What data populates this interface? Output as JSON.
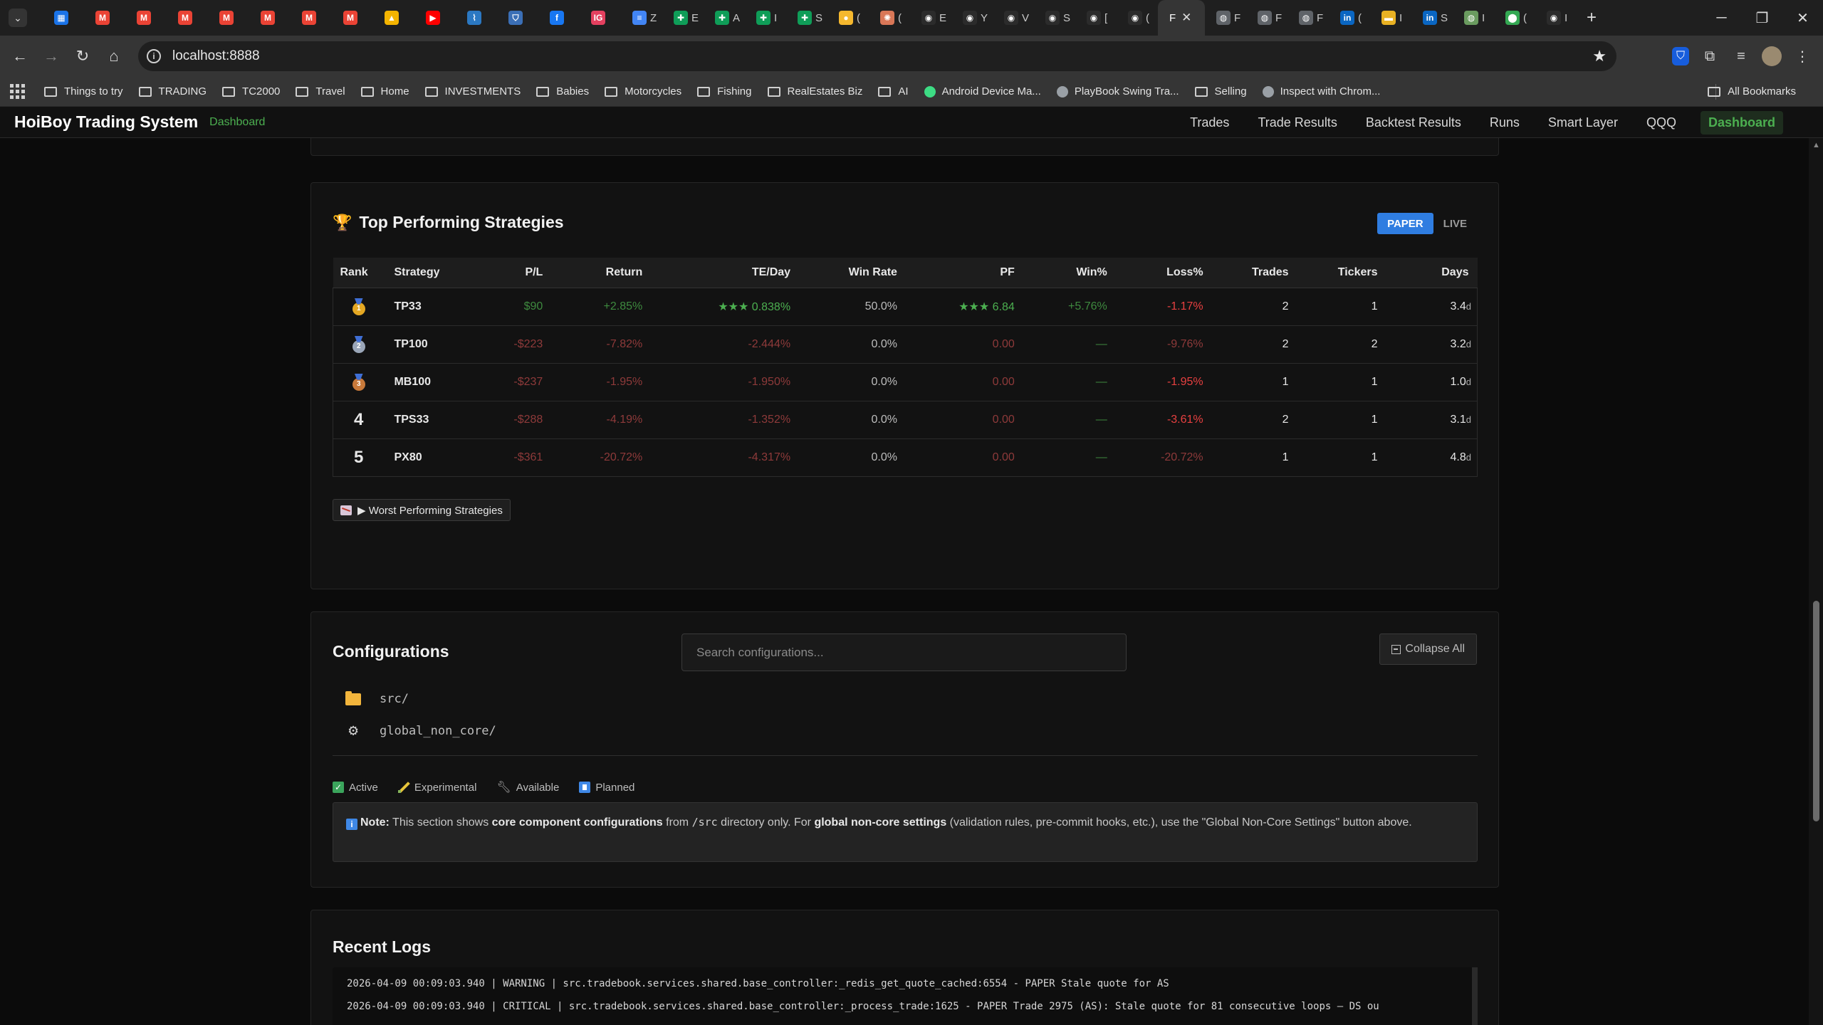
{
  "browser": {
    "tabs": [
      {
        "icon": "calendar-icon",
        "color": "#1a73e8",
        "glyph": "▦",
        "label": ""
      },
      {
        "icon": "gmail-icon",
        "color": "#ea4335",
        "glyph": "M",
        "label": ""
      },
      {
        "icon": "gmail-icon",
        "color": "#ea4335",
        "glyph": "M",
        "label": ""
      },
      {
        "icon": "gmail-icon",
        "color": "#ea4335",
        "glyph": "M",
        "label": ""
      },
      {
        "icon": "gmail-icon",
        "color": "#ea4335",
        "glyph": "M",
        "label": ""
      },
      {
        "icon": "gmail-icon",
        "color": "#ea4335",
        "glyph": "M",
        "label": ""
      },
      {
        "icon": "gmail-icon",
        "color": "#ea4335",
        "glyph": "M",
        "label": ""
      },
      {
        "icon": "gmail-icon",
        "color": "#ea4335",
        "glyph": "M",
        "label": ""
      },
      {
        "icon": "drive-icon",
        "color": "#f4b400",
        "glyph": "▲",
        "label": ""
      },
      {
        "icon": "youtube-icon",
        "color": "#ff0000",
        "glyph": "▶",
        "label": ""
      },
      {
        "icon": "chart-icon",
        "color": "#2b78c2",
        "glyph": "⌇",
        "label": ""
      },
      {
        "icon": "shield-icon",
        "color": "#3b6fb6",
        "glyph": "⛉",
        "label": ""
      },
      {
        "icon": "f-icon",
        "color": "#1877f2",
        "glyph": "f",
        "label": ""
      },
      {
        "icon": "ig-icon",
        "color": "#e4405f",
        "glyph": "IG",
        "label": ""
      },
      {
        "icon": "docs-icon",
        "color": "#4285f4",
        "glyph": "≡",
        "label": "Z"
      },
      {
        "icon": "sheets-icon",
        "color": "#0f9d58",
        "glyph": "✚",
        "label": "E"
      },
      {
        "icon": "sheets-icon",
        "color": "#0f9d58",
        "glyph": "✚",
        "label": "A"
      },
      {
        "icon": "sheets-icon",
        "color": "#0f9d58",
        "glyph": "✚",
        "label": "I"
      },
      {
        "icon": "sheets-icon",
        "color": "#0f9d58",
        "glyph": "✚",
        "label": "S"
      },
      {
        "icon": "sun-icon",
        "color": "#f5b82e",
        "glyph": "●",
        "label": "("
      },
      {
        "icon": "spark-icon",
        "color": "#d97757",
        "glyph": "✺",
        "label": "("
      },
      {
        "icon": "github-icon",
        "color": "#2b2b2b",
        "glyph": "◉",
        "label": "E"
      },
      {
        "icon": "github-icon",
        "color": "#2b2b2b",
        "glyph": "◉",
        "label": "Y"
      },
      {
        "icon": "github-icon",
        "color": "#2b2b2b",
        "glyph": "◉",
        "label": "V"
      },
      {
        "icon": "github-icon",
        "color": "#2b2b2b",
        "glyph": "◉",
        "label": "S"
      },
      {
        "icon": "github-icon",
        "color": "#2b2b2b",
        "glyph": "◉",
        "label": "["
      },
      {
        "icon": "github-icon",
        "color": "#2b2b2b",
        "glyph": "◉",
        "label": "("
      }
    ],
    "active_tab_label": "F",
    "tabs_after": [
      {
        "icon": "globe-icon",
        "color": "#5f6368",
        "glyph": "◍",
        "label": "F"
      },
      {
        "icon": "globe-icon",
        "color": "#5f6368",
        "glyph": "◍",
        "label": "F"
      },
      {
        "icon": "globe-icon",
        "color": "#5f6368",
        "glyph": "◍",
        "label": "F"
      },
      {
        "icon": "linkedin-icon",
        "color": "#0a66c2",
        "glyph": "in",
        "label": "("
      },
      {
        "icon": "flag-icon",
        "color": "#e8b123",
        "glyph": "▬",
        "label": "I"
      },
      {
        "icon": "linkedin-icon",
        "color": "#0a66c2",
        "glyph": "in",
        "label": "S"
      },
      {
        "icon": "globe-icon",
        "color": "#6a9b5f",
        "glyph": "◍",
        "label": "I"
      },
      {
        "icon": "maps-icon",
        "color": "#34a853",
        "glyph": "⬤",
        "label": "("
      },
      {
        "icon": "github-icon",
        "color": "#2b2b2b",
        "glyph": "◉",
        "label": "I"
      }
    ],
    "url": "localhost:8888",
    "bookmarks": [
      {
        "type": "folder",
        "label": "Things to try"
      },
      {
        "type": "folder",
        "label": "TRADING"
      },
      {
        "type": "folder",
        "label": "TC2000"
      },
      {
        "type": "folder",
        "label": "Travel"
      },
      {
        "type": "folder",
        "label": "Home"
      },
      {
        "type": "folder",
        "label": "INVESTMENTS"
      },
      {
        "type": "folder",
        "label": "Babies"
      },
      {
        "type": "folder",
        "label": "Motorcycles"
      },
      {
        "type": "folder",
        "label": "Fishing"
      },
      {
        "type": "folder",
        "label": "RealEstates Biz"
      },
      {
        "type": "folder",
        "label": "AI"
      },
      {
        "type": "site",
        "label": "Android Device Ma...",
        "color": "#3ddc84"
      },
      {
        "type": "site",
        "label": "PlayBook Swing Tra...",
        "color": "#9aa0a6"
      },
      {
        "type": "folder",
        "label": "Selling"
      },
      {
        "type": "site",
        "label": "Inspect with Chrom...",
        "color": "#9aa0a6"
      }
    ],
    "all_bookmarks_label": "All Bookmarks"
  },
  "app": {
    "title": "HoiBoy Trading System",
    "subtitle": "Dashboard",
    "nav": [
      "Trades",
      "Trade Results",
      "Backtest Results",
      "Runs",
      "Smart Layer",
      "QQQ"
    ],
    "nav_active": "Dashboard"
  },
  "strategies": {
    "title": "Top Performing Strategies",
    "mode_paper": "PAPER",
    "mode_live": "LIVE",
    "columns": [
      "Rank",
      "Strategy",
      "P/L",
      "Return",
      "TE/Day",
      "Win Rate",
      "PF",
      "Win%",
      "Loss%",
      "Trades",
      "Tickers",
      "Days"
    ],
    "rows": [
      {
        "rank": "1",
        "medal": "gold",
        "strategy": "TP33",
        "pl": "$90",
        "ret": "+2.85%",
        "te": "★★★ 0.838%",
        "wr": "50.0%",
        "pf": "★★★ 6.84",
        "win": "+5.76%",
        "loss": "-1.17%",
        "trades": "2",
        "tickers": "1",
        "days": "3.4",
        "suffix": "d"
      },
      {
        "rank": "2",
        "medal": "silver",
        "strategy": "TP100",
        "pl": "-$223",
        "ret": "-7.82%",
        "te": "-2.444%",
        "wr": "0.0%",
        "pf": "0.00",
        "win": "—",
        "loss": "-9.76%",
        "trades": "2",
        "tickers": "2",
        "days": "3.2",
        "suffix": "d"
      },
      {
        "rank": "3",
        "medal": "bronze",
        "strategy": "MB100",
        "pl": "-$237",
        "ret": "-1.95%",
        "te": "-1.950%",
        "wr": "0.0%",
        "pf": "0.00",
        "win": "—",
        "loss": "-1.95%",
        "trades": "1",
        "tickers": "1",
        "days": "1.0",
        "suffix": "d"
      },
      {
        "rank": "4",
        "medal": "",
        "strategy": "TPS33",
        "pl": "-$288",
        "ret": "-4.19%",
        "te": "-1.352%",
        "wr": "0.0%",
        "pf": "0.00",
        "win": "—",
        "loss": "-3.61%",
        "trades": "2",
        "tickers": "1",
        "days": "3.1",
        "suffix": "d"
      },
      {
        "rank": "5",
        "medal": "",
        "strategy": "PX80",
        "pl": "-$361",
        "ret": "-20.72%",
        "te": "-4.317%",
        "wr": "0.0%",
        "pf": "0.00",
        "win": "—",
        "loss": "-20.72%",
        "trades": "1",
        "tickers": "1",
        "days": "4.8",
        "suffix": "d"
      }
    ],
    "worst_label": "▶ Worst Performing Strategies"
  },
  "configurations": {
    "title": "Configurations",
    "search_placeholder": "Search configurations...",
    "collapse_label": "Collapse All",
    "tree": [
      {
        "icon": "folder-icon",
        "label": "src/"
      },
      {
        "icon": "gear-icon",
        "label": "global_non_core/"
      }
    ],
    "legend": [
      "Active",
      "Experimental",
      "Available",
      "Planned"
    ],
    "note": {
      "label": "Note:",
      "t1": " This section shows ",
      "b1": "core component configurations",
      "t2": " from ",
      "code": "/src",
      "t3": " directory only. For ",
      "b2": "global non-core settings",
      "t4": " (validation rules, pre-commit hooks, etc.), use the \"Global Non-Core Settings\" button above."
    }
  },
  "logs": {
    "title": "Recent Logs",
    "lines": [
      "2026-04-09 00:09:03.940 | WARNING | src.tradebook.services.shared.base_controller:_redis_get_quote_cached:6554 - PAPER Stale quote for AS",
      "2026-04-09 00:09:03.940 | CRITICAL | src.tradebook.services.shared.base_controller:_process_trade:1625 - PAPER Trade 2975 (AS): Stale quote for 81 consecutive loops — DS ou"
    ]
  },
  "colors": {
    "accent_green": "#4caf50",
    "loss_red": "#e84040",
    "paper_blue": "#2f7de1"
  }
}
